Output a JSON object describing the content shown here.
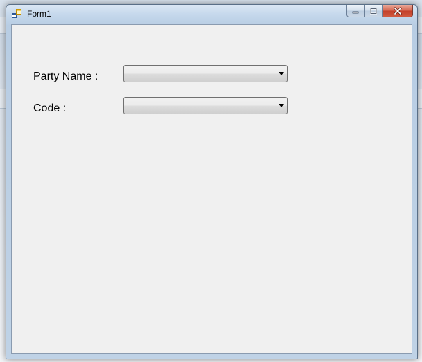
{
  "window": {
    "title": "Form1"
  },
  "form": {
    "fields": [
      {
        "label": "Party Name :",
        "value": ""
      },
      {
        "label": "Code :",
        "value": ""
      }
    ]
  },
  "icons": {
    "app": "form-app-icon",
    "minimize": "minimize-icon",
    "maximize": "maximize-icon",
    "close": "close-icon",
    "dropdown": "chevron-down-icon"
  },
  "colors": {
    "client_background": "#f0f0f0",
    "close_button": "#c3402a"
  }
}
